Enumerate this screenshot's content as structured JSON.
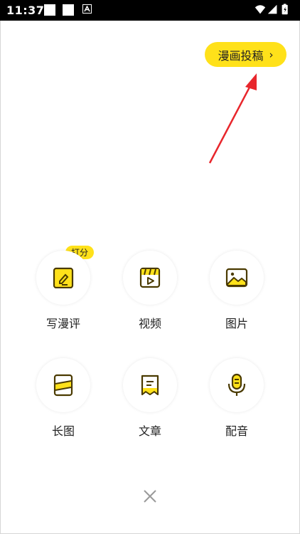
{
  "status_bar": {
    "time": "11:37"
  },
  "submit_button": {
    "label": "漫画投稿",
    "chevron": "›"
  },
  "badge": {
    "label": "打分"
  },
  "grid": {
    "items": [
      {
        "label": "写漫评",
        "icon": "review-edit-icon"
      },
      {
        "label": "视频",
        "icon": "video-icon"
      },
      {
        "label": "图片",
        "icon": "image-icon"
      },
      {
        "label": "长图",
        "icon": "long-image-icon"
      },
      {
        "label": "文章",
        "icon": "article-icon"
      },
      {
        "label": "配音",
        "icon": "microphone-icon"
      }
    ]
  },
  "colors": {
    "accent": "#ffe11a",
    "annotation_arrow": "#e8262c",
    "icon_stroke": "#4a3a00"
  }
}
